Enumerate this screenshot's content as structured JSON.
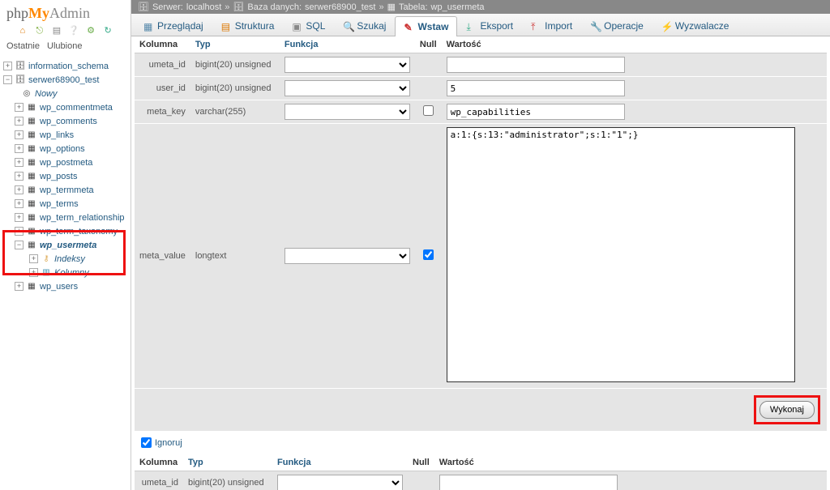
{
  "logo": {
    "p1": "php",
    "p2": "My",
    "p3": "Admin"
  },
  "nav": {
    "recent": "Ostatnie",
    "favorites": "Ulubione"
  },
  "tree": {
    "db1": "information_schema",
    "db2": "serwer68900_test",
    "new": "Nowy",
    "tables": [
      "wp_commentmeta",
      "wp_comments",
      "wp_links",
      "wp_options",
      "wp_postmeta",
      "wp_posts",
      "wp_termmeta",
      "wp_terms",
      "wp_term_relationship",
      "wp_term_taxonomy"
    ],
    "selected_table": "wp_usermeta",
    "sub_indexes": "Indeksy",
    "sub_columns": "Kolumny",
    "last_table": "wp_users"
  },
  "breadcrumb": {
    "server_label": "Serwer:",
    "server": "localhost",
    "db_label": "Baza danych:",
    "db": "serwer68900_test",
    "table_label": "Tabela:",
    "table": "wp_usermeta"
  },
  "tabs": {
    "browse": "Przeglądaj",
    "structure": "Struktura",
    "sql": "SQL",
    "search": "Szukaj",
    "insert": "Wstaw",
    "export": "Eksport",
    "import": "Import",
    "operations": "Operacje",
    "triggers": "Wyzwalacze"
  },
  "headers": {
    "column": "Kolumna",
    "type": "Typ",
    "function": "Funkcja",
    "null": "Null",
    "value": "Wartość"
  },
  "rows": {
    "umeta_id": {
      "name": "umeta_id",
      "type": "bigint(20) unsigned",
      "value": ""
    },
    "user_id": {
      "name": "user_id",
      "type": "bigint(20) unsigned",
      "value": "5"
    },
    "meta_key": {
      "name": "meta_key",
      "type": "varchar(255)",
      "value": "wp_capabilities"
    },
    "meta_value": {
      "name": "meta_value",
      "type": "longtext",
      "value": "a:1:{s:13:\"administrator\";s:1:\"1\";}"
    }
  },
  "submit": {
    "label": "Wykonaj"
  },
  "ignore": {
    "label": "Ignoruj"
  }
}
